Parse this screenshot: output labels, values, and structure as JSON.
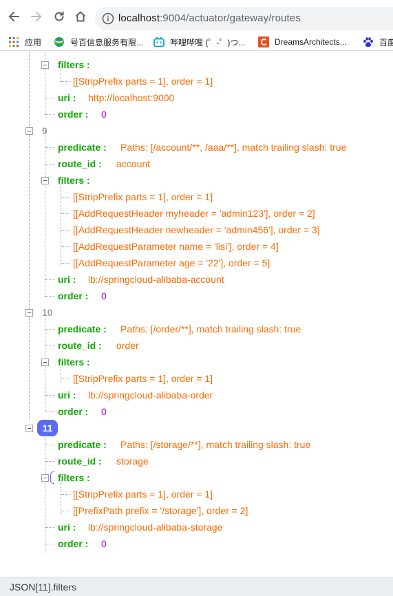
{
  "browser": {
    "url_host": "localhost",
    "url_rest": ":9004/actuator/gateway/routes",
    "bookmarks": [
      {
        "label": "应用",
        "icon": "apps-grid-icon"
      },
      {
        "label": "号百信息服务有限...",
        "icon": "globe-icon"
      },
      {
        "label": "哔哩哔哩 (゜-゜)つ...",
        "icon": "bilibili-icon"
      },
      {
        "label": "DreamsArchitects...",
        "icon": "c-logo-icon"
      },
      {
        "label": "百度",
        "icon": "baidu-paw-icon"
      }
    ]
  },
  "json_view": {
    "keys": {
      "filters": "filters",
      "uri": "uri",
      "order": "order",
      "predicate": "predicate",
      "route_id": "route_id",
      "sep": " :"
    },
    "route8_tail": {
      "filters": [
        "[[StripPrefix parts = 1], order = 1]"
      ],
      "uri": "http://localhost:9000",
      "order": "0"
    },
    "routes": [
      {
        "index": "9",
        "predicate": "Paths: [/account/**, /aaa/**], match trailing slash: true",
        "route_id": "account",
        "filters": [
          "[[StripPrefix parts = 1], order = 1]",
          "[[AddRequestHeader myheader = 'admin123'], order = 2]",
          "[[AddRequestHeader newheader = 'admin456'], order = 3]",
          "[[AddRequestParameter name = 'lisi'], order = 4]",
          "[[AddRequestParameter age = '22'], order = 5]"
        ],
        "uri": "lb://springcloud-alibaba-account",
        "order": "0"
      },
      {
        "index": "10",
        "predicate": "Paths: [/order/**], match trailing slash: true",
        "route_id": "order",
        "filters": [
          "[[StripPrefix parts = 1], order = 1]"
        ],
        "uri": "lb://springcloud-alibaba-order",
        "order": "0"
      },
      {
        "index": "11",
        "predicate": "Paths: [/storage/**], match trailing slash: true",
        "route_id": "storage",
        "filters": [
          "[[StripPrefix parts = 1], order = 1]",
          "[[PrefixPath prefix = '/storage'], order = 2]"
        ],
        "uri": "lb://springcloud-alibaba-storage",
        "order": "0"
      }
    ],
    "selected_route_index": "11"
  },
  "status_path": "JSON[11].filters",
  "colors": {
    "key": "#0ea800",
    "string": "#ff6a00",
    "number": "#c000e0",
    "badge": "#5b6cf2"
  }
}
